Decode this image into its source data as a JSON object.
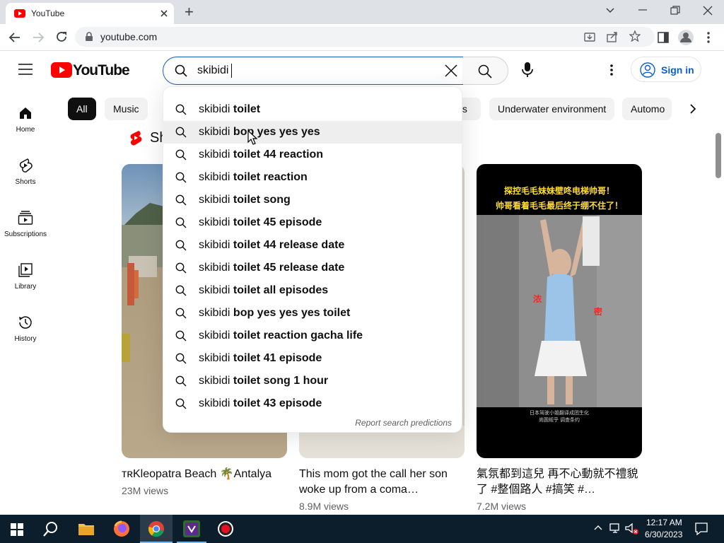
{
  "browser": {
    "tab_title": "YouTube",
    "url": "youtube.com",
    "new_tab": "+"
  },
  "header": {
    "logo_text": "YouTube",
    "search_query": "skibidi",
    "signin_label": "Sign in"
  },
  "chips": [
    "All",
    "Music",
    "Underwater environment",
    "Automo"
  ],
  "chip_partial": "ts",
  "nav": [
    {
      "label": "Home",
      "icon": "home-icon"
    },
    {
      "label": "Shorts",
      "icon": "shorts-icon"
    },
    {
      "label": "Subscriptions",
      "icon": "subscriptions-icon"
    },
    {
      "label": "Library",
      "icon": "library-icon"
    },
    {
      "label": "History",
      "icon": "history-icon"
    }
  ],
  "shorts_heading": "Sh",
  "suggestions": [
    {
      "prefix": "skibidi",
      "rest": " toilet"
    },
    {
      "prefix": "skibidi",
      "rest": " bop yes yes yes"
    },
    {
      "prefix": "skibidi",
      "rest": " toilet 44 reaction"
    },
    {
      "prefix": "skibidi",
      "rest": " toilet reaction"
    },
    {
      "prefix": "skibidi",
      "rest": " toilet song"
    },
    {
      "prefix": "skibidi",
      "rest": " toilet 45 episode"
    },
    {
      "prefix": "skibidi",
      "rest": " toilet 44 release date"
    },
    {
      "prefix": "skibidi",
      "rest": " toilet 45 release date"
    },
    {
      "prefix": "skibidi",
      "rest": " toilet all episodes"
    },
    {
      "prefix": "skibidi",
      "rest": " bop yes yes yes toilet"
    },
    {
      "prefix": "skibidi",
      "rest": " toilet reaction gacha life"
    },
    {
      "prefix": "skibidi",
      "rest": " toilet 41 episode"
    },
    {
      "prefix": "skibidi",
      "rest": " toilet song 1 hour"
    },
    {
      "prefix": "skibidi",
      "rest": " toilet 43 episode"
    }
  ],
  "report_label": "Report search predictions",
  "shorts": [
    {
      "title": "ᴛʀKleopatra Beach 🌴Antalya",
      "views": "23M views"
    },
    {
      "title": "This mom got the call her son woke up from a coma…",
      "views": "8.9M views"
    },
    {
      "title": "氣氛都到這兒 再不心動就不禮貌了 #整個路人 #搞笑 #…",
      "views": "7.2M views"
    }
  ],
  "short3_overlay": [
    "探控毛毛妹妹壁咚电梯帅哥！",
    "帅哥看着毛毛最后终于绷不住了！"
  ],
  "short3_side": [
    "浓",
    "密"
  ],
  "short3_caption": [
    "日本驾驶小姐翻译成团生化",
    "尚圆规乎    调查条约"
  ],
  "taskbar": {
    "time": "12:17 AM",
    "date": "6/30/2023"
  },
  "colors": {
    "brand_red": "#ff0000",
    "link_blue": "#065fd4",
    "taskbar_bg": "#0c1d2c"
  }
}
